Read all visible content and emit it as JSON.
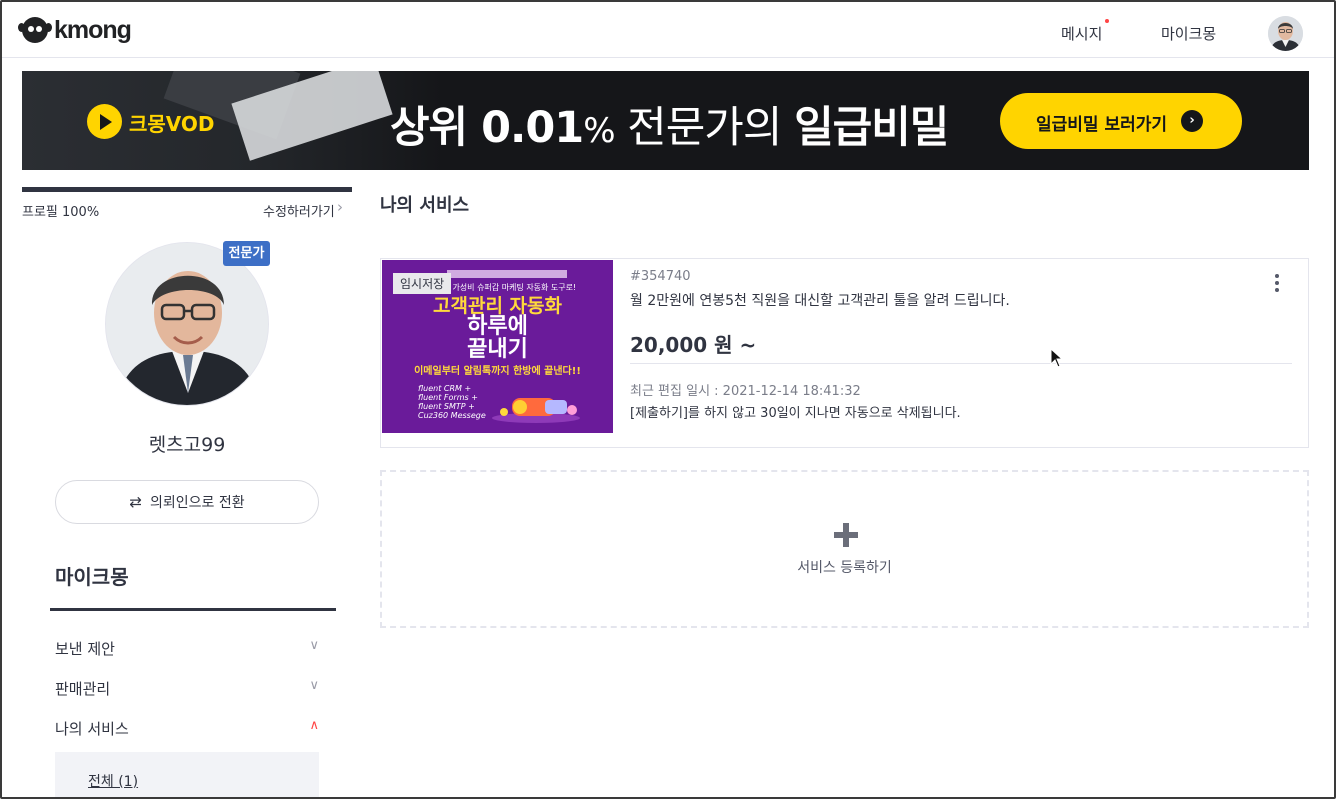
{
  "header": {
    "logo_text": "kmong",
    "nav_message": "메시지",
    "nav_mykmong": "마이크몽"
  },
  "banner": {
    "vod_label": "크몽VOD",
    "headline_prefix": "상위 ",
    "headline_number": "0.01",
    "headline_percent": "%",
    "headline_mid": " 전문가의 ",
    "headline_bold": "일급비밀",
    "cta_label": "일급비밀 보러가기"
  },
  "sidebar": {
    "profile_progress": "프로필 100%",
    "profile_progress_value": 1.0,
    "edit_link": "수정하러가기",
    "expert_badge": "전문가",
    "username": "렛츠고99",
    "switch_button": "의뢰인으로 전환",
    "section_title": "마이크몽",
    "menu": [
      {
        "label": "보낸 제안",
        "expanded": false
      },
      {
        "label": "판매관리",
        "expanded": false
      },
      {
        "label": "나의 서비스",
        "expanded": true
      }
    ],
    "submenu": [
      {
        "label": "전체 (1)",
        "selected": true
      }
    ]
  },
  "main": {
    "page_title": "나의 서비스",
    "services": [
      {
        "thumbnail_tag": "임시저장",
        "thumbnail_lines": {
          "top": "원, 가성비 슈퍼갑 마케팅 자동화 도구로!",
          "title1": "고객관리 자동화",
          "title2a": "하루에",
          "title2b": "끝내기",
          "subtitle": "이메일부터 알림톡까지 한방에 끝낸다!!",
          "list": [
            "fluent CRM +",
            "fluent Forms +",
            "fluent SMTP +",
            "Cuz360 Messege"
          ]
        },
        "id": "#354740",
        "title": "월 2만원에 연봉5천 직원을 대신할 고객관리 툴을 알려 드립니다.",
        "price": "20,000 원 ~",
        "edited": "최근 편집 일시 : 2021-12-14 18:41:32",
        "notice": "[제출하기]를 하지 않고 30일이 지나면 자동으로 삭제됩니다."
      }
    ],
    "add_service_label": "서비스 등록하기"
  },
  "colors": {
    "accent_yellow": "#ffd400",
    "badge_blue": "#3d6fc6",
    "thumbnail_purple": "#6a1b9a",
    "notification_red": "#ff4545"
  }
}
